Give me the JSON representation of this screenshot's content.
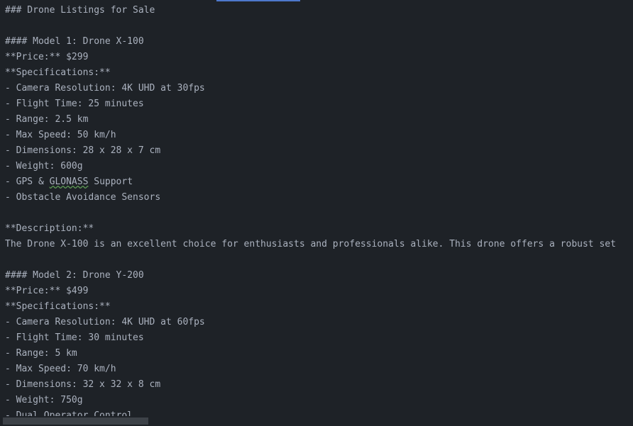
{
  "editor": {
    "lines": {
      "l0": "### Drone Listings for Sale",
      "l1": "",
      "l2": "#### Model 1: Drone X-100",
      "l3": "**Price:** $299",
      "l4": "**Specifications:**",
      "l5": "- Camera Resolution: 4K UHD at 30fps",
      "l6": "- Flight Time: 25 minutes",
      "l7": "- Range: 2.5 km",
      "l8": "- Max Speed: 50 km/h",
      "l9": "- Dimensions: 28 x 28 x 7 cm",
      "l10": "- Weight: 600g",
      "l11_prefix": "- GPS & ",
      "l11_spell": "GLONASS",
      "l11_suffix": " Support",
      "l12": "- Obstacle Avoidance Sensors",
      "l13": "",
      "l14": "**Description:**",
      "l15": "The Drone X-100 is an excellent choice for enthusiasts and professionals alike. This drone offers a robust set",
      "l16": "",
      "l17": "#### Model 2: Drone Y-200",
      "l18": "**Price:** $499",
      "l19": "**Specifications:**",
      "l20": "- Camera Resolution: 4K UHD at 60fps",
      "l21": "- Flight Time: 30 minutes",
      "l22": "- Range: 5 km",
      "l23": "- Max Speed: 70 km/h",
      "l24": "- Dimensions: 32 x 32 x 8 cm",
      "l25": "- Weight: 750g",
      "l26": "- Dual Operator Control"
    }
  }
}
